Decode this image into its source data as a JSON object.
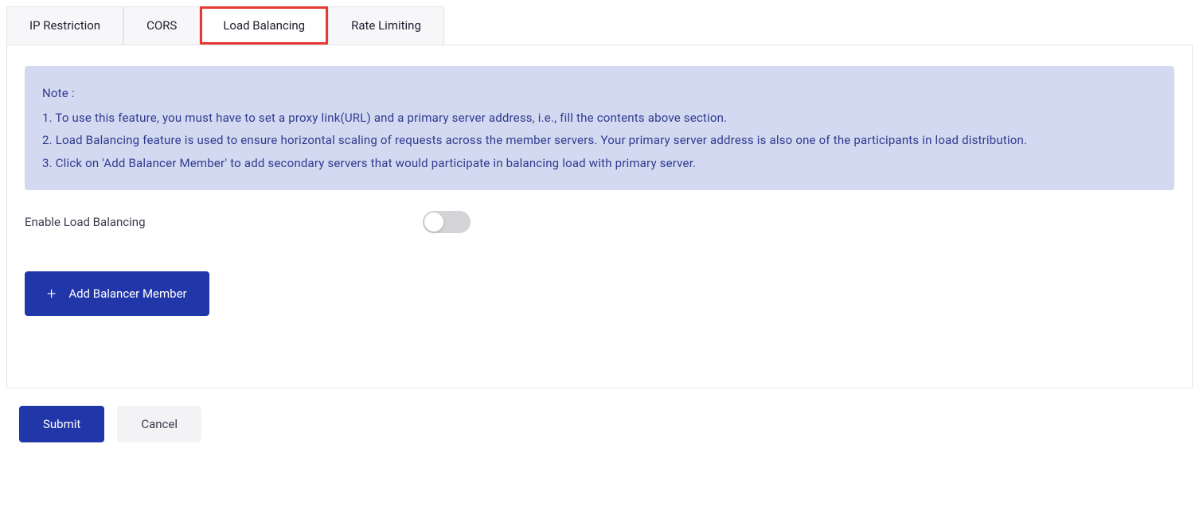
{
  "tabs": [
    {
      "label": "IP Restriction"
    },
    {
      "label": "CORS"
    },
    {
      "label": "Load Balancing"
    },
    {
      "label": "Rate Limiting"
    }
  ],
  "note": {
    "title": "Note :",
    "line1": "1. To use this feature, you must have to set a proxy link(URL) and a primary server address, i.e., fill the contents above section.",
    "line2": "2. Load Balancing feature is used to ensure horizontal scaling of requests across the member servers. Your primary server address is also one of the participants in load distribution.",
    "line3": "3. Click on 'Add Balancer Member' to add secondary servers that would participate in balancing load with primary server."
  },
  "toggle": {
    "label": "Enable Load Balancing",
    "enabled": false
  },
  "buttons": {
    "addMember": "Add Balancer Member",
    "submit": "Submit",
    "cancel": "Cancel"
  }
}
